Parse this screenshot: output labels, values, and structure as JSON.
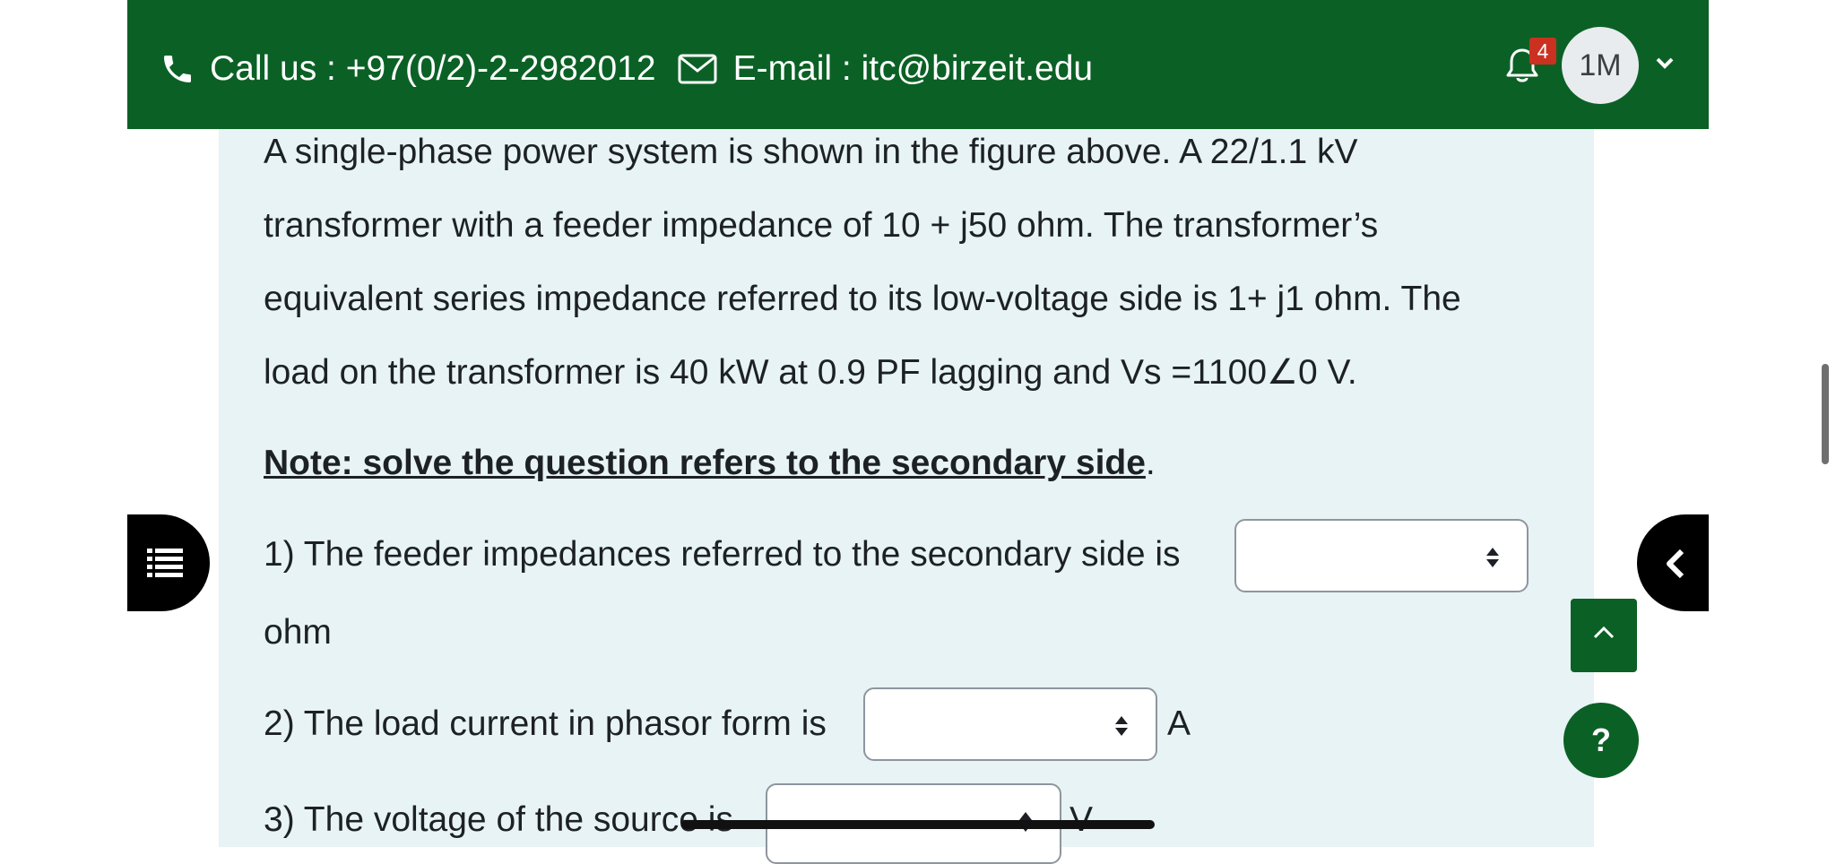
{
  "header": {
    "phone_text": "Call us : +97(0/2)-2-2982012",
    "email_text": "E-mail : itc@birzeit.edu",
    "notification_count": "4",
    "user_initials": "1M",
    "bg_color": "#0b6125"
  },
  "question": {
    "paragraph_lines": [
      "A single-phase power system is shown in the figure above. A 22/1.1 kV",
      "transformer with a feeder impedance of 10 + j50 ohm. The transformer’s",
      "equivalent series impedance referred to its low-voltage side is 1+ j1 ohm. The",
      "load on the transformer is 40 kW at 0.9 PF lagging and Vs =1100∠0 V."
    ],
    "note_text": "Note: solve the question refers to the secondary side",
    "note_end": ".",
    "parts": [
      {
        "prompt": "1) The feeder impedances referred to the secondary side is",
        "selected": "",
        "unit": "ohm"
      },
      {
        "prompt": "2) The load current in phasor form is",
        "selected": "",
        "unit": "A"
      },
      {
        "prompt": "3) The voltage of the source is",
        "selected": "",
        "unit": "V"
      }
    ]
  },
  "buttons": {
    "help_label": "?"
  },
  "icons": [
    "phone-icon",
    "envelope-icon",
    "bell-icon",
    "chevron-down-icon",
    "list-icon",
    "chevron-left-icon",
    "chevron-up-icon",
    "sort-icon"
  ]
}
